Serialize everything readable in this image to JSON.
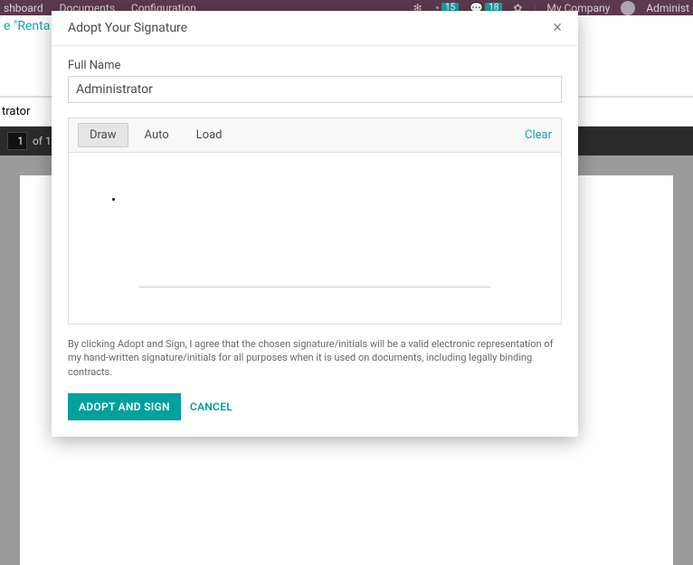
{
  "topnav": {
    "items": [
      "shboard",
      "Documents",
      "Configuration"
    ],
    "badge1": "15",
    "badge2": "18",
    "company": "My Company",
    "user": "Administ"
  },
  "subheader": {
    "text": "e \"Renta"
  },
  "crumb": {
    "text": "trator"
  },
  "pager": {
    "current": "1",
    "of": "of 1"
  },
  "modal": {
    "title": "Adopt Your Signature",
    "close": "×",
    "fullname_label": "Full Name",
    "fullname_value": "Administrator",
    "tabs": {
      "draw": "Draw",
      "auto": "Auto",
      "load": "Load"
    },
    "clear": "Clear",
    "legal": "By clicking Adopt and Sign, I agree that the chosen signature/initials will be a valid electronic representation of my hand-written signature/initials for all purposes when it is used on documents, including legally binding contracts.",
    "adopt_btn": "ADOPT AND SIGN",
    "cancel_btn": "CANCEL"
  }
}
